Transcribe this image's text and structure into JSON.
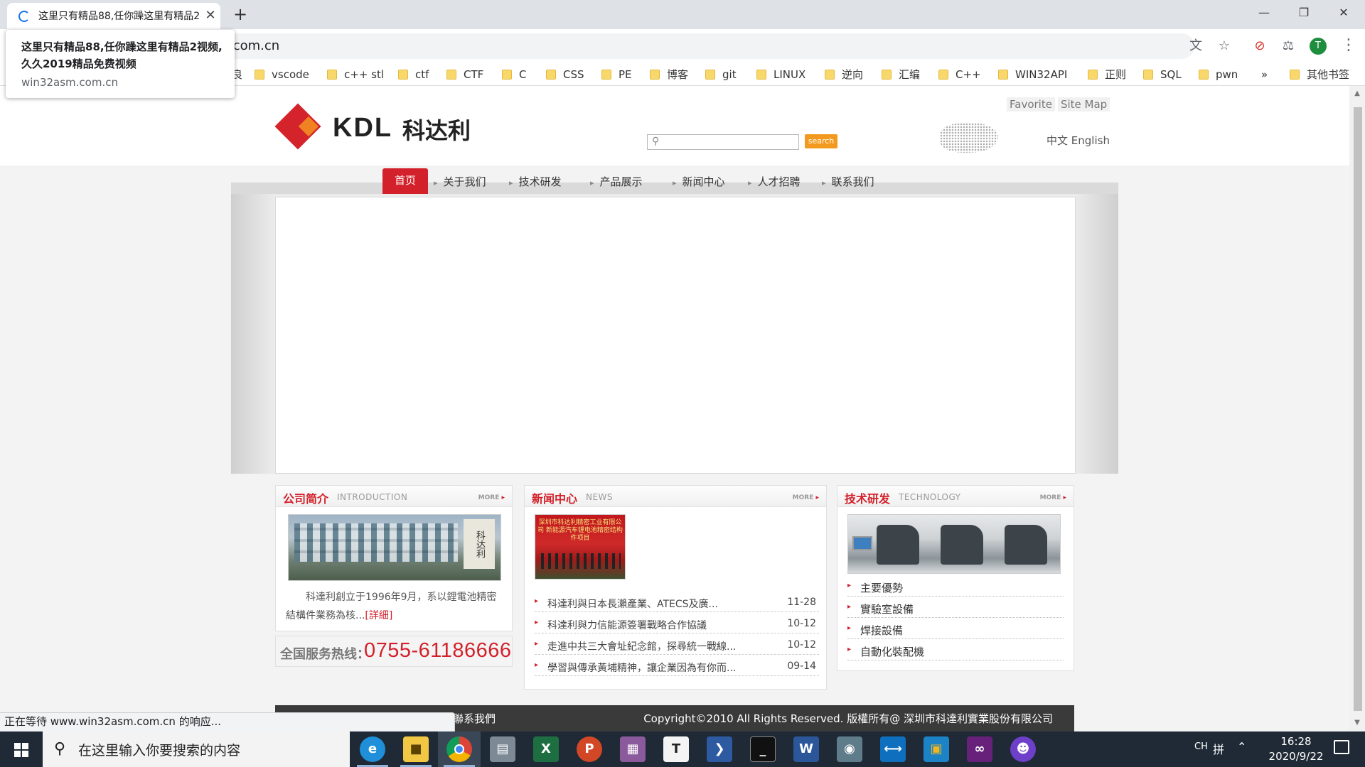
{
  "browser": {
    "tab_title": "这里只有精品88,任你躁这里有精品2视频,久久2019精品免费视频",
    "tab_close": "✕",
    "new_tab": "+",
    "url_suffix": ".com.cn",
    "profile_initial": "T",
    "tooltip_title": "这里只有精品88,任你躁这里有精品2视频,久久2019精品免费视频",
    "tooltip_url": "win32asm.com.cn",
    "status": "正在等待 www.win32asm.com.cn 的响应...",
    "bookmarks": [
      "良",
      "vscode",
      "c++ stl",
      "ctf",
      "CTF",
      "C",
      "CSS",
      "PE",
      "博客",
      "git",
      "LINUX",
      "逆向",
      "汇编",
      "C++",
      "WIN32API",
      "正则",
      "SQL",
      "pwn"
    ],
    "bookmarks_overflow": "»",
    "other_bookmarks": "其他书签"
  },
  "site": {
    "logo_latin": "KDL",
    "logo_cn": "科达利",
    "top_links": [
      "Favorite",
      "Site Map"
    ],
    "search_button": "search",
    "lang_cn": "中文",
    "lang_en": "English",
    "nav": [
      "首页",
      "关于我们",
      "技术研发",
      "产品展示",
      "新闻中心",
      "人才招聘",
      "联系我们"
    ],
    "intro": {
      "title_cn": "公司简介",
      "title_en": "INTRODUCTION",
      "more": "MORE",
      "photo_sign": "科达利",
      "text": "科達利創立于1996年9月，系以鋰電池精密結構件業務為核...",
      "detail": "[詳細]"
    },
    "hotline_label": "全国服务热线：",
    "hotline_number": "0755-61186666",
    "news": {
      "title_cn": "新闻中心",
      "title_en": "NEWS",
      "more": "MORE",
      "photo_text": "深圳市科达利精密工业有限公司 新能源汽车锂电池精密结构件项目",
      "items": [
        {
          "title": "科達利與日本長瀨產業、ATECS及廣...",
          "date": "11-28"
        },
        {
          "title": "科達利與力信能源簽署戰略合作協議",
          "date": "10-12"
        },
        {
          "title": "走進中共三大會址紀念館，探尋統一戰線...",
          "date": "10-12"
        },
        {
          "title": "學習與傳承黃埔精神，讓企業因為有你而...",
          "date": "09-14"
        }
      ]
    },
    "tech": {
      "title_cn": "技术研发",
      "title_en": "TECHNOLOGY",
      "more": "MORE",
      "items": [
        "主要優勢",
        "實驗室設備",
        "焊接設備",
        "自動化裝配機"
      ]
    },
    "footer_links": "聯系我們",
    "footer_copyright": "Copyright©2010 All Rights Reserved. 版權所有@ 深圳市科達利實業股份有限公司"
  },
  "taskbar": {
    "search_placeholder": "在这里输入你要搜索的内容",
    "apps": [
      "edge",
      "file-explorer",
      "chrome",
      "scanner",
      "excel",
      "powerpoint",
      "winrar",
      "typora",
      "powershell",
      "terminal",
      "word",
      "screenshot-tool",
      "vscode",
      "virtualbox",
      "visual-studio",
      "github-desktop"
    ],
    "input_lang": "CH",
    "ime": "拼",
    "time": "16:28",
    "date": "2020/9/22"
  }
}
